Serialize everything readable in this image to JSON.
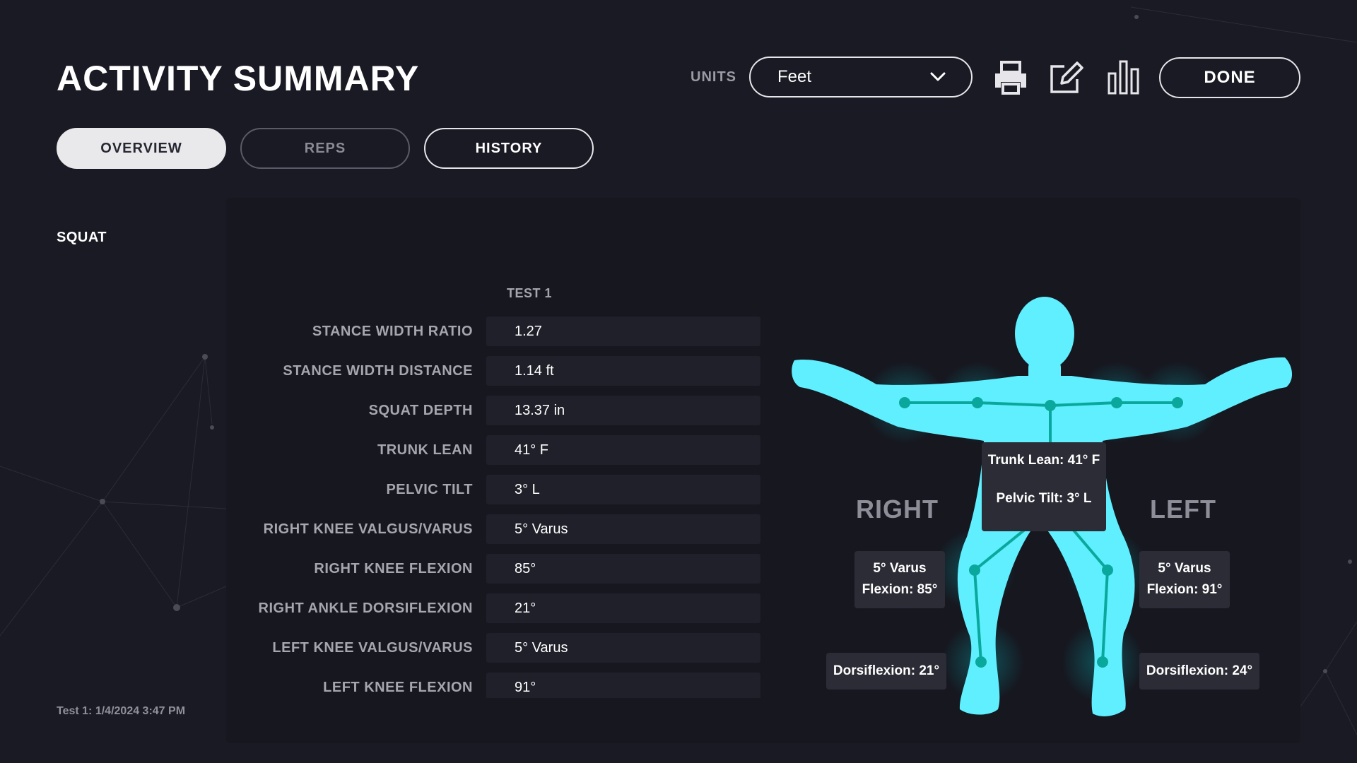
{
  "header": {
    "title": "ACTIVITY SUMMARY",
    "units_label": "UNITS",
    "units_value": "Feet",
    "done_label": "DONE"
  },
  "tabs": [
    {
      "label": "OVERVIEW",
      "state": "active"
    },
    {
      "label": "REPS",
      "state": "inactive"
    },
    {
      "label": "HISTORY",
      "state": "default"
    }
  ],
  "sidebar": {
    "activity": "SQUAT",
    "timestamp": "Test 1: 1/4/2024 3:47 PM"
  },
  "table": {
    "column_header": "TEST 1",
    "rows": [
      {
        "label": "STANCE WIDTH RATIO",
        "value": "1.27"
      },
      {
        "label": "STANCE WIDTH DISTANCE",
        "value": "1.14 ft"
      },
      {
        "label": "SQUAT DEPTH",
        "value": "13.37 in"
      },
      {
        "label": "TRUNK LEAN",
        "value": "41° F"
      },
      {
        "label": "PELVIC TILT",
        "value": "3° L"
      },
      {
        "label": "RIGHT KNEE VALGUS/VARUS",
        "value": "5° Varus"
      },
      {
        "label": "RIGHT KNEE FLEXION",
        "value": "85°"
      },
      {
        "label": "RIGHT ANKLE DORSIFLEXION",
        "value": "21°"
      },
      {
        "label": "LEFT KNEE VALGUS/VARUS",
        "value": "5° Varus"
      },
      {
        "label": "LEFT KNEE FLEXION",
        "value": "91°"
      }
    ]
  },
  "figure": {
    "right_label": "RIGHT",
    "left_label": "LEFT",
    "trunk_lean": "Trunk Lean: 41° F",
    "pelvic_tilt": "Pelvic Tilt: 3°  L",
    "right_knee_varus": "5° Varus",
    "right_knee_flexion": "Flexion: 85°",
    "left_knee_varus": "5° Varus",
    "left_knee_flexion": "Flexion: 91°",
    "right_dorsiflexion": "Dorsiflexion: 21°",
    "left_dorsiflexion": "Dorsiflexion: 24°"
  },
  "icons": {
    "units_dropdown": "chevron-down-icon",
    "print": "printer-icon",
    "edit": "edit-icon",
    "chart": "bar-chart-icon"
  },
  "colors": {
    "background": "#191a23",
    "panel": "#16171f",
    "body": "#5fefff",
    "joint": "#0aa89c"
  }
}
